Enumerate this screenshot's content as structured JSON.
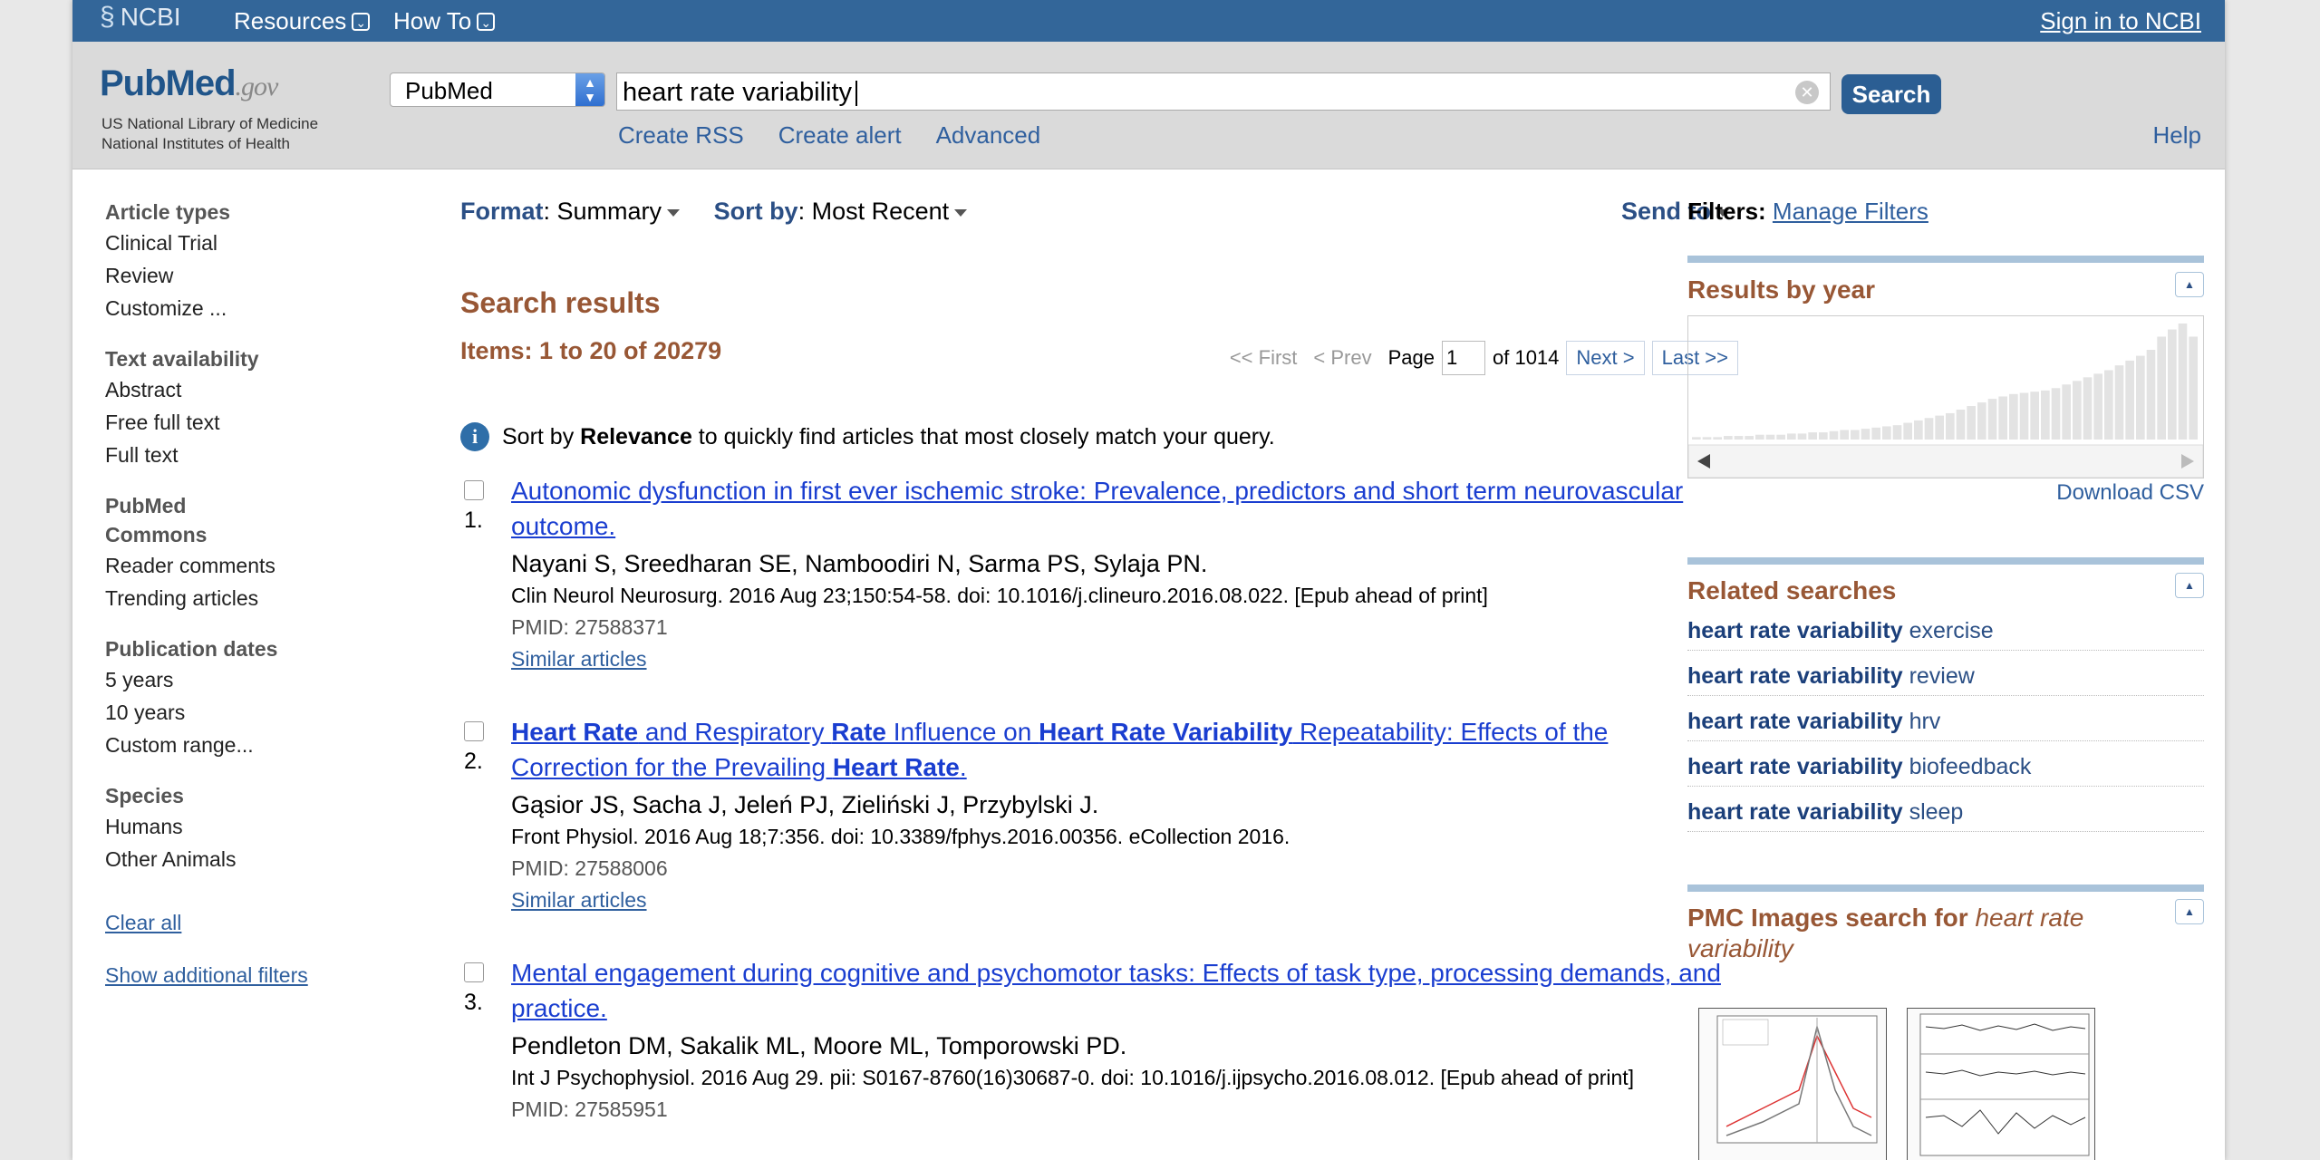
{
  "topbar": {
    "logo": "NCBI",
    "resources": "Resources",
    "howto": "How To",
    "signin": "Sign in to NCBI"
  },
  "header": {
    "logo_main": "PubMed",
    "logo_gov": ".gov",
    "inst1": "US National Library of Medicine",
    "inst2": "National Institutes of Health",
    "db": "PubMed",
    "query": "heart rate variability",
    "search_btn": "Search",
    "links": [
      "Create RSS",
      "Create alert",
      "Advanced"
    ],
    "help": "Help"
  },
  "leftnav": {
    "article_types": "Article types",
    "clinical_trial": "Clinical Trial",
    "review": "Review",
    "customize": "Customize ...",
    "text_avail": "Text availability",
    "abstract": "Abstract",
    "free_full": "Free full text",
    "full_text": "Full text",
    "pubmed_commons_1": "PubMed",
    "pubmed_commons_2": "Commons",
    "reader_comments": "Reader comments",
    "trending": "Trending articles",
    "pub_dates": "Publication dates",
    "y5": "5 years",
    "y10": "10 years",
    "custom_range": "Custom range...",
    "species": "Species",
    "humans": "Humans",
    "other_animals": "Other Animals",
    "clear_all": "Clear all",
    "show_filters": "Show additional filters"
  },
  "main": {
    "format_label": "Format",
    "format_value": "Summary",
    "sort_label": "Sort by",
    "sort_value": "Most Recent",
    "send_to": "Send to",
    "search_results": "Search results",
    "items": "Items: 1 to 20 of 20279",
    "pager": {
      "first": "<< First",
      "prev": "< Prev",
      "page_label": "Page",
      "page_value": "1",
      "of": "of 1014",
      "next": "Next >",
      "last": "Last >>"
    },
    "info_pre": "Sort by ",
    "info_bold": "Relevance",
    "info_post": " to quickly find articles that most closely match your query.",
    "results": [
      {
        "num": "1.",
        "title": "Autonomic dysfunction in first ever ischemic stroke: Prevalence, predictors and short term neurovascular outcome.",
        "authors": "Nayani S, Sreedharan SE, Namboodiri N, Sarma PS, Sylaja PN.",
        "cite": "Clin Neurol Neurosurg. 2016 Aug 23;150:54-58. doi: 10.1016/j.clineuro.2016.08.022. [Epub ahead of print]",
        "pmid": "PMID: 27588371",
        "similar": "Similar articles"
      },
      {
        "num": "2.",
        "title_parts": [
          "Heart Rate",
          " and Respiratory ",
          "Rate",
          " Influence on ",
          "Heart Rate Variability",
          " Repeatability: Effects of the Correction for the Prevailing ",
          "Heart Rate",
          "."
        ],
        "authors": "Gąsior JS, Sacha J, Jeleń PJ, Zieliński J, Przybylski J.",
        "cite": "Front Physiol. 2016 Aug 18;7:356. doi: 10.3389/fphys.2016.00356. eCollection 2016.",
        "pmid": "PMID: 27588006",
        "similar": "Similar articles"
      },
      {
        "num": "3.",
        "title": "Mental engagement during cognitive and psychomotor tasks: Effects of task type, processing demands, and practice.",
        "authors": "Pendleton DM, Sakalik ML, Moore ML, Tomporowski PD.",
        "cite": "Int J Psychophysiol. 2016 Aug 29. pii: S0167-8760(16)30687-0. doi: 10.1016/j.ijpsycho.2016.08.012. [Epub ahead of print]",
        "pmid": "PMID: 27585951"
      }
    ]
  },
  "right": {
    "filters_label": "Filters:",
    "manage_filters": "Manage Filters",
    "results_by_year": "Results by year",
    "download_csv": "Download CSV",
    "related_title": "Related searches",
    "related": [
      {
        "bold": "heart rate variability",
        "suffix": " exercise"
      },
      {
        "bold": "heart rate variability",
        "suffix": " review"
      },
      {
        "bold": "heart rate variability",
        "suffix": " hrv"
      },
      {
        "bold": "heart rate variability",
        "suffix": " biofeedback"
      },
      {
        "bold": "heart rate variability",
        "suffix": " sleep"
      }
    ],
    "pmc_prefix": "PMC Images search for ",
    "pmc_query": "heart rate variability"
  },
  "year_bars": [
    0.02,
    0.02,
    0.02,
    0.03,
    0.03,
    0.03,
    0.04,
    0.04,
    0.04,
    0.05,
    0.05,
    0.06,
    0.06,
    0.07,
    0.08,
    0.08,
    0.09,
    0.1,
    0.11,
    0.12,
    0.14,
    0.16,
    0.18,
    0.2,
    0.22,
    0.25,
    0.28,
    0.31,
    0.34,
    0.36,
    0.38,
    0.39,
    0.4,
    0.41,
    0.43,
    0.46,
    0.49,
    0.52,
    0.55,
    0.58,
    0.62,
    0.66,
    0.7,
    0.75,
    0.86,
    0.92,
    0.97,
    0.86
  ]
}
